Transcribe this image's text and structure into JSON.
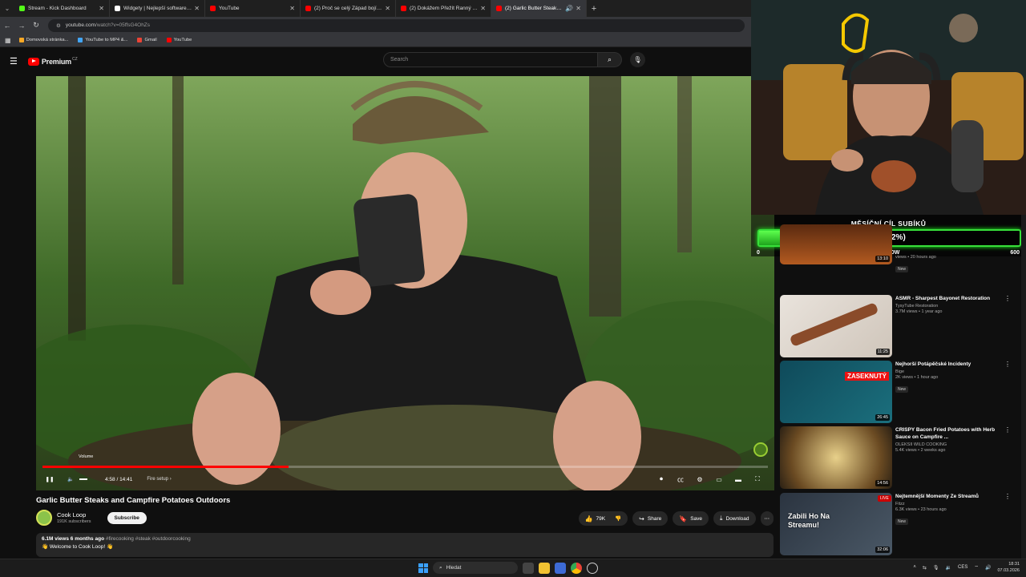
{
  "browser": {
    "tabs": [
      {
        "title": "Stream - Kick Dashboard",
        "color": "#53fc18",
        "active": false
      },
      {
        "title": "Widgety | Nejlepší software pro",
        "color": "#ffffff",
        "active": false
      },
      {
        "title": "YouTube",
        "color": "#ff0000",
        "active": false
      },
      {
        "title": "(2) Proč se celý Západ bojí těcht",
        "color": "#ff0000",
        "active": false
      },
      {
        "title": "(2) Dokážem Přežít Ranný Rutin",
        "color": "#ff0000",
        "active": false
      },
      {
        "title": "(2) Garlic Butter Steaks and",
        "color": "#ff0000",
        "active": true
      }
    ],
    "url_host": "youtube.com",
    "url_path": "/watch?v=05ffsG4OhZs",
    "bookmarks": [
      "Domovská stránka...",
      "YouTube to MP4 &...",
      "Gmail",
      "YouTube"
    ]
  },
  "header": {
    "logo_text": "Premium",
    "logo_region": "CZ",
    "search_placeholder": "Search"
  },
  "player": {
    "current_time": "4:58",
    "duration": "14:41",
    "time_display": "4:58 / 14:41",
    "progress_fraction": 0.339,
    "chapter": "Fire setup",
    "volume_tooltip": "Volume"
  },
  "video": {
    "title": "Garlic Butter Steaks and Campfire Potatoes Outdoors",
    "channel": "Cook Loop",
    "subscribers": "191K subscribers",
    "subscribe_label": "Subscribe",
    "likes": "79K",
    "share_label": "Share",
    "save_label": "Save",
    "download_label": "Download",
    "views": "6.1M views",
    "age": "6 months ago",
    "tags": "#firecooking #steak #outdoorcooking",
    "description": "👋 Welcome to Cook Loop! 👋"
  },
  "goal": {
    "title": "MĚSÍČNÍ CÍL SUBÍKŮ",
    "value_text": "72 (12%)",
    "fraction": 0.12,
    "min": "0",
    "max": "600",
    "status": "RIGHT NOW"
  },
  "sidebar": {
    "items": [
      {
        "title": "",
        "meta": "views • 20 hours ago",
        "badge": "New",
        "duration": "13:10"
      },
      {
        "title": "ASMR - Sharpest Bayonet Restoration",
        "channel": "TysyTube Restoration",
        "meta": "3.7M views • 1 year ago",
        "badge": "",
        "duration": "11:25"
      },
      {
        "title": "Nejhorší Potápěčské Incidenty",
        "channel": "Bige",
        "meta": "2K views • 1 hour ago",
        "badge": "New",
        "duration": "26:45",
        "thumb_text": "ZASEKNUTÝ"
      },
      {
        "title": "CRISPY Bacon Fried Potatoes with Herb Sauce on Campfire ...",
        "channel": "OLEKSII WILD COOKING",
        "meta": "5.4K views • 2 weeks ago",
        "badge": "",
        "duration": "14:56"
      },
      {
        "title": "Nejtemnější Momenty Ze Streamů",
        "channel": "Fitzz",
        "meta": "6.3K views • 23 hours ago",
        "badge": "New",
        "duration": "32:06",
        "thumb_text": "Zabili Ho Na Streamu!",
        "live": "LIVE"
      }
    ]
  },
  "taskbar": {
    "search_label": "Hledat",
    "lang": "CES",
    "time": "18:31",
    "date": "07.03.2026"
  }
}
